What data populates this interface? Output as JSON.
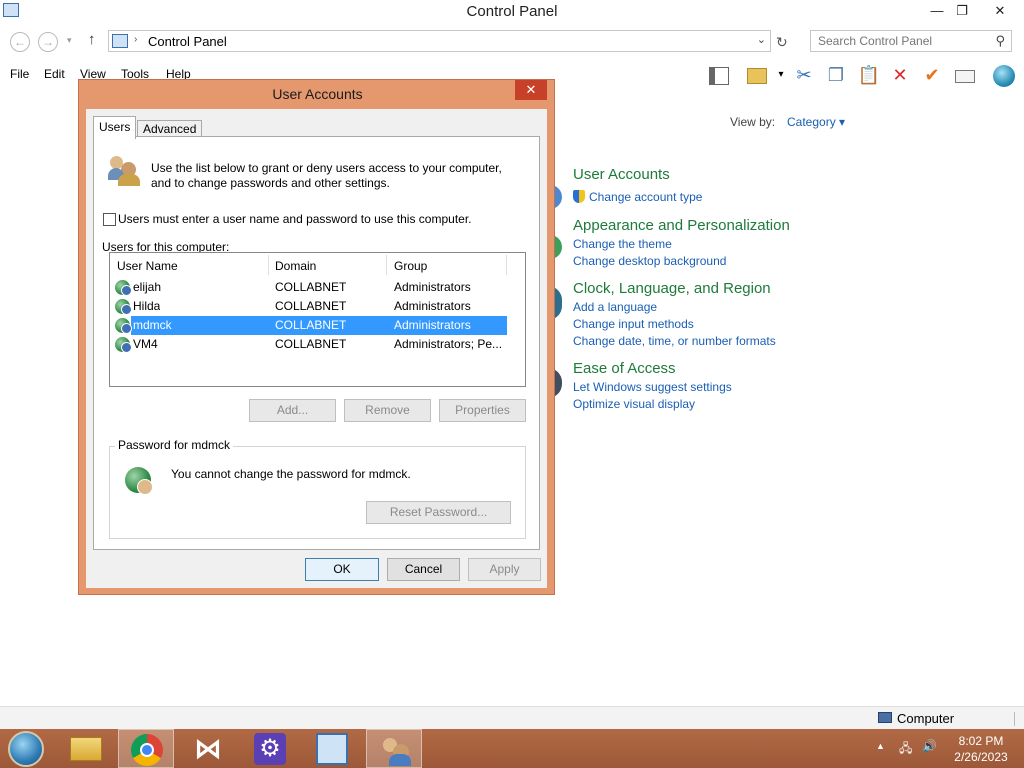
{
  "window": {
    "title": "Control Panel",
    "minimize": "—",
    "maximize": "❐",
    "close": "✕"
  },
  "address": {
    "path": "Control Panel",
    "search_placeholder": "Search Control Panel"
  },
  "menu": [
    "File",
    "Edit",
    "View",
    "Tools",
    "Help"
  ],
  "control_panel": {
    "view_by_label": "View by:",
    "view_by_value": "Category ▾",
    "categories": [
      {
        "title": "User Accounts",
        "links": [
          "Change account type"
        ]
      },
      {
        "title": "Appearance and Personalization",
        "links": [
          "Change the theme",
          "Change desktop background"
        ]
      },
      {
        "title": "Clock, Language, and Region",
        "links": [
          "Add a language",
          "Change input methods",
          "Change date, time, or number formats"
        ]
      },
      {
        "title": "Ease of Access",
        "links": [
          "Let Windows suggest settings",
          "Optimize visual display"
        ]
      }
    ]
  },
  "dialog": {
    "title": "User Accounts",
    "close": "✕",
    "tabs": [
      "Users",
      "Advanced"
    ],
    "intro_line1": "Use the list below to grant or deny users access to your computer,",
    "intro_line2": "and to change passwords and other settings.",
    "checkbox_label": "Users must enter a user name and password to use this computer.",
    "checkbox_checked": false,
    "list_label": "Users for this computer:",
    "columns": [
      "User Name",
      "Domain",
      "Group"
    ],
    "users": [
      {
        "name": "elijah",
        "domain": "COLLABNET",
        "group": "Administrators"
      },
      {
        "name": "Hilda",
        "domain": "COLLABNET",
        "group": "Administrators"
      },
      {
        "name": "mdmck",
        "domain": "COLLABNET",
        "group": "Administrators"
      },
      {
        "name": "VM4",
        "domain": "COLLABNET",
        "group": "Administrators; Pe..."
      }
    ],
    "selected_index": 2,
    "buttons": {
      "add": "Add...",
      "remove": "Remove",
      "properties": "Properties"
    },
    "password_group_label": "Password for mdmck",
    "password_message": "You cannot change the password for mdmck.",
    "reset_password": "Reset Password...",
    "ok": "OK",
    "cancel": "Cancel",
    "apply": "Apply"
  },
  "statusbar": {
    "location": "Computer"
  },
  "taskbar": {
    "time": "8:02 PM",
    "date": "2/26/2023"
  }
}
